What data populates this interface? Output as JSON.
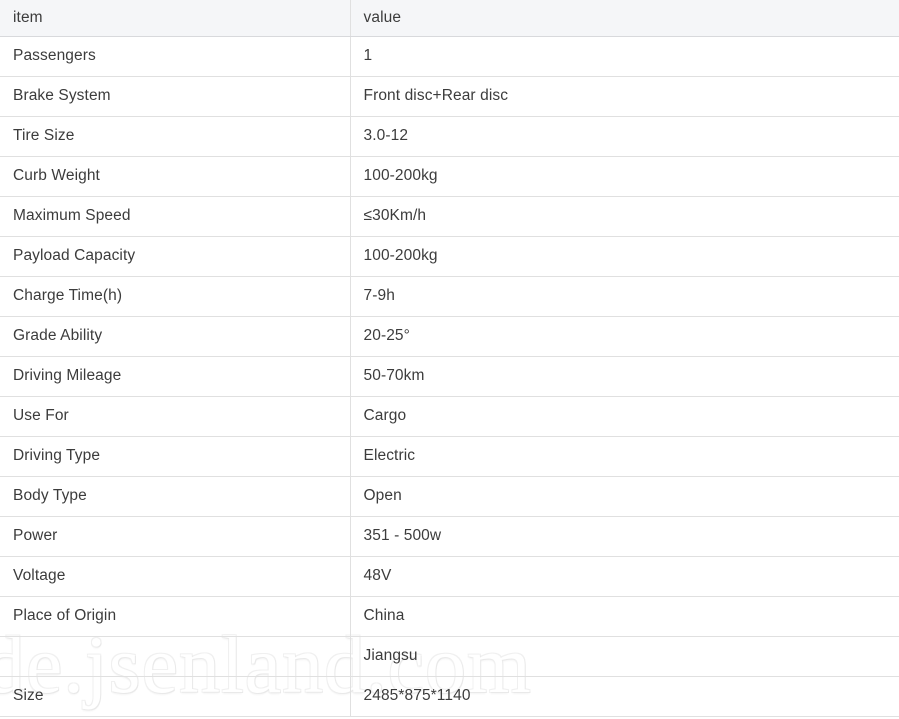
{
  "table": {
    "headers": {
      "item": "item",
      "value": "value"
    },
    "rows": [
      {
        "item": "Passengers",
        "value": "1"
      },
      {
        "item": "Brake System",
        "value": "Front disc+Rear disc"
      },
      {
        "item": "Tire Size",
        "value": "3.0-12"
      },
      {
        "item": "Curb Weight",
        "value": "100-200kg"
      },
      {
        "item": "Maximum Speed",
        "value": "≤30Km/h"
      },
      {
        "item": "Payload Capacity",
        "value": "100-200kg"
      },
      {
        "item": "Charge Time(h)",
        "value": "7-9h"
      },
      {
        "item": "Grade Ability",
        "value": "20-25°"
      },
      {
        "item": "Driving Mileage",
        "value": "50-70km"
      },
      {
        "item": "Use For",
        "value": "Cargo"
      },
      {
        "item": "Driving Type",
        "value": "Electric"
      },
      {
        "item": "Body Type",
        "value": "Open"
      },
      {
        "item": "Power",
        "value": "351 - 500w"
      },
      {
        "item": "Voltage",
        "value": "48V"
      },
      {
        "item": "Place of Origin",
        "value": "China"
      },
      {
        "item": "",
        "value": "Jiangsu"
      },
      {
        "item": "Size",
        "value": "2485*875*1140"
      }
    ]
  },
  "watermark": {
    "text": "de.jsenland.com",
    "color": "#f0f0f0"
  }
}
